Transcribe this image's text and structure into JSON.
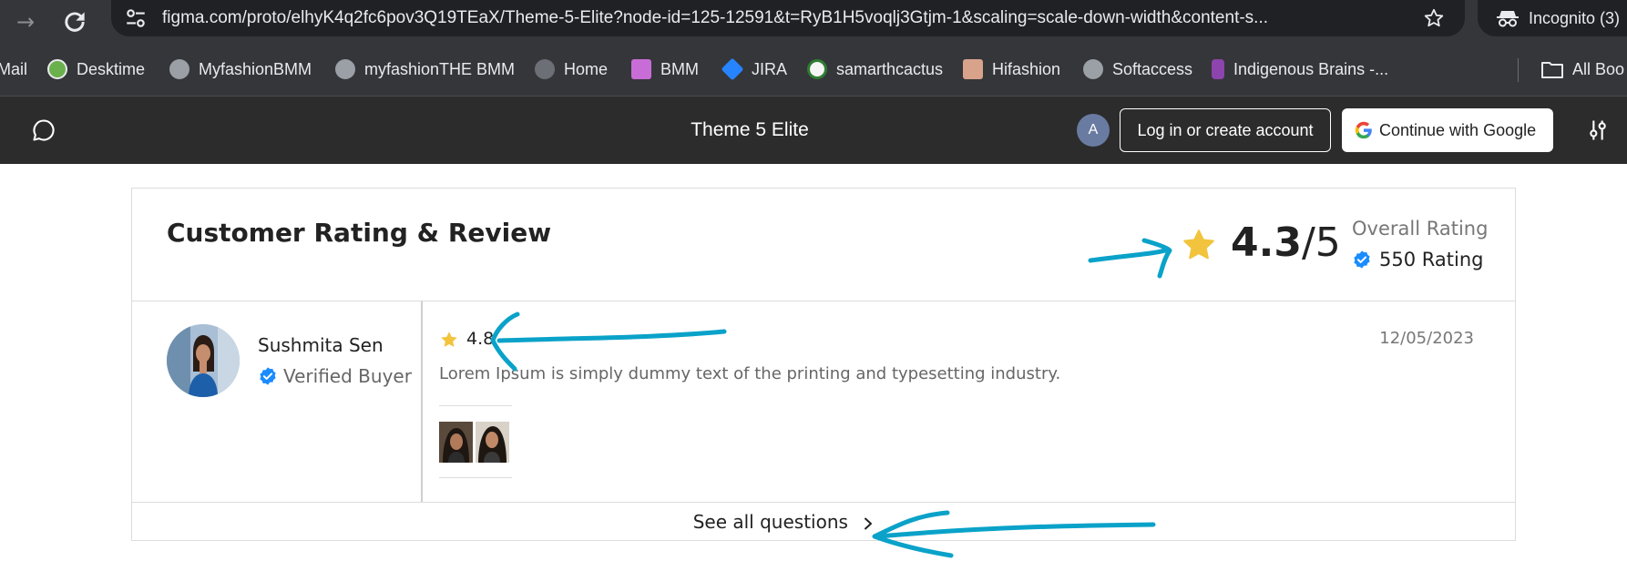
{
  "browser": {
    "url": "figma.com/proto/elhyK4q2fc6pov3Q19TEaX/Theme-5-Elite?node-id=125-12591&t=RyB1H5voqlj3Gtjm-1&scaling=scale-down-width&content-s...",
    "incognito_label": "Incognito (3)",
    "bookmarks": [
      {
        "label": "Mail",
        "icon": "gmail-icon",
        "color": "#35363a"
      },
      {
        "label": "Desktime",
        "icon": "desktime-icon",
        "color": "#6ab04c"
      },
      {
        "label": "MyfashionBMM",
        "icon": "globe-icon",
        "color": "#9aa0a6"
      },
      {
        "label": "myfashionTHE BMM",
        "icon": "globe-icon",
        "color": "#9aa0a6"
      },
      {
        "label": "Home",
        "icon": "globe-icon",
        "color": "#6c7076"
      },
      {
        "label": "BMM",
        "icon": "bmm-icon",
        "color": "#c86dd7"
      },
      {
        "label": "JIRA",
        "icon": "jira-icon",
        "color": "#2684ff"
      },
      {
        "label": "samarthcactus",
        "icon": "cactus-icon",
        "color": "#f5f5f5"
      },
      {
        "label": "Hifashion",
        "icon": "hifashion-icon",
        "color": "#d9a38b"
      },
      {
        "label": "Softaccess",
        "icon": "globe-icon",
        "color": "#9aa0a6"
      },
      {
        "label": "Indigenous Brains -...",
        "icon": "indigenous-icon",
        "color": "#8e44ad"
      }
    ],
    "all_bookmarks_label": "All Boo"
  },
  "prototype": {
    "title": "Theme 5 Elite",
    "avatar_letter": "A",
    "login_label": "Log in or create account",
    "google_label": "Continue with Google"
  },
  "reviews": {
    "title": "Customer Rating & Review",
    "overall_score": "4.3",
    "overall_max": "/5",
    "overall_label": "Overall Rating",
    "rating_count": "550 Rating",
    "items": [
      {
        "name": "Sushmita Sen",
        "badge": "Verified Buyer",
        "rating": "4.8",
        "date": "12/05/2023",
        "text": "Lorem Ipsum is simply dummy text of the printing and typesetting industry."
      }
    ],
    "see_all_label": "See all questions"
  },
  "colors": {
    "star": "#f2c33c",
    "verified_badge": "#1a8cff",
    "annotation": "#0aa2c9",
    "chrome_bg": "#35363a",
    "proto_bar_bg": "#2c2c2c"
  }
}
